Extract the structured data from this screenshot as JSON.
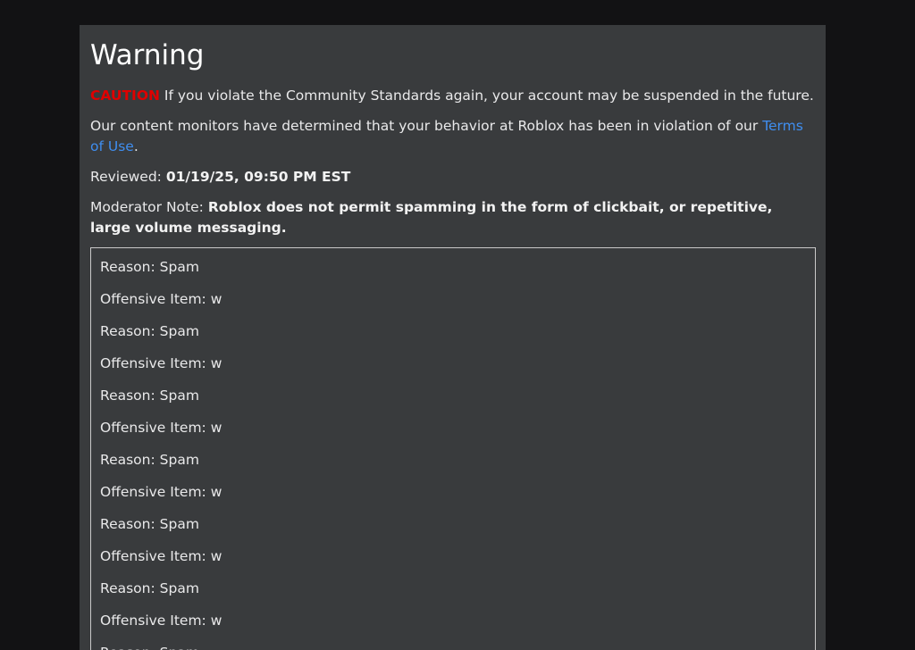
{
  "page": {
    "title": "Warning",
    "caution_label": "CAUTION",
    "caution_text": " If you violate the Community Standards again, your account may be suspended in the future.",
    "monitors_text": "Our content monitors have determined that your behavior at Roblox has been in violation of our ",
    "terms_link": "Terms of Use",
    "monitors_end": ".",
    "reviewed_label": "Reviewed: ",
    "reviewed_value": "01/19/25, 09:50 PM EST",
    "note_label": "Moderator Note: ",
    "note_value": "Roblox does not permit spamming in the form of clickbait, or repetitive, large volume messaging."
  },
  "reasons": [
    "Reason: Spam",
    "Offensive Item: w",
    "Reason: Spam",
    "Offensive Item: w",
    "Reason: Spam",
    "Offensive Item: w",
    "Reason: Spam",
    "Offensive Item: w",
    "Reason: Spam",
    "Offensive Item: w",
    "Reason: Spam",
    "Offensive Item: w",
    "Reason: Spam"
  ],
  "colors": {
    "background": "#121214",
    "panel": "#393b3d",
    "caution": "#e00000",
    "link": "#3f8ef0"
  }
}
